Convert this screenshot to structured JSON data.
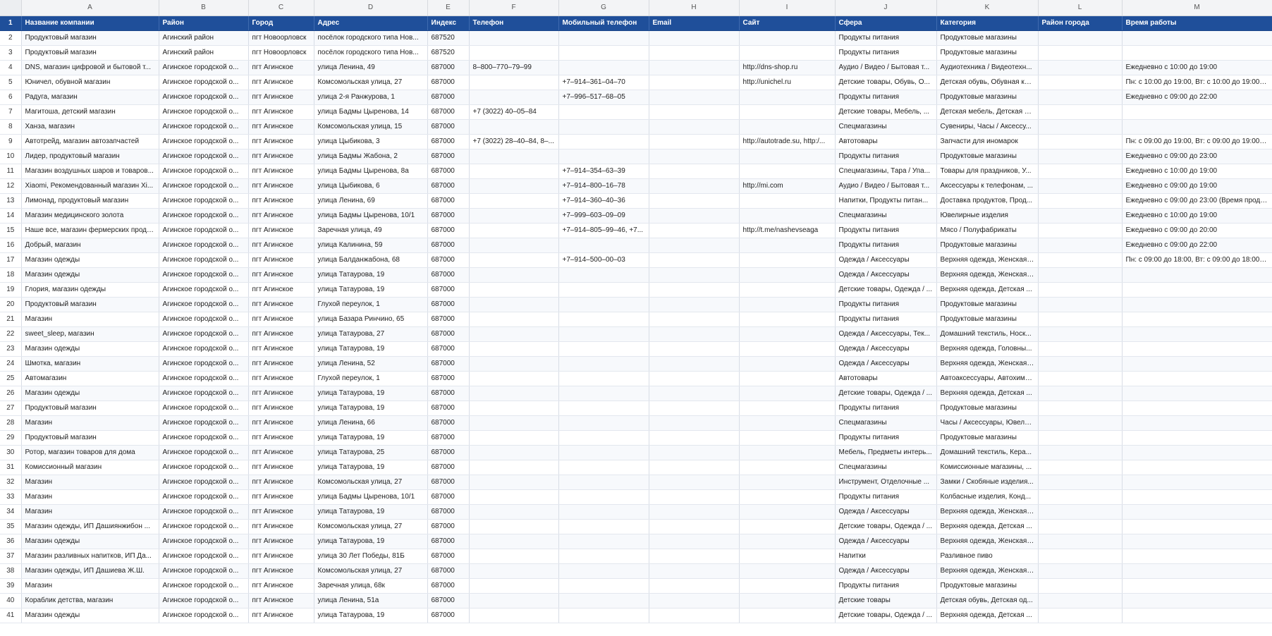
{
  "columns": [
    "",
    "A",
    "B",
    "C",
    "D",
    "E",
    "F",
    "G",
    "H",
    "I",
    "J",
    "K",
    "L",
    "M"
  ],
  "header": {
    "row_number": "1",
    "cells": [
      "Название компании",
      "Район",
      "Город",
      "Адрес",
      "Индекс",
      "Телефон",
      "Мобильный телефон",
      "Email",
      "Сайт",
      "Сфера",
      "Категория",
      "Район города",
      "Время работы"
    ]
  },
  "rows": [
    [
      "2",
      "Продуктовый магазин",
      "Агинский район",
      "пгт Новоорловск",
      "посёлок городского типа Нов...",
      "687520",
      "",
      "",
      "",
      "",
      "Продукты питания",
      "Продуктовые магазины",
      "",
      ""
    ],
    [
      "3",
      "Продуктовый магазин",
      "Агинский район",
      "пгт Новоорловск",
      "посёлок городского типа Нов...",
      "687520",
      "",
      "",
      "",
      "",
      "Продукты питания",
      "Продуктовые магазины",
      "",
      ""
    ],
    [
      "4",
      "DNS, магазин цифровой и бытовой т...",
      "Агинское городской о...",
      "пгт Агинское",
      "улица Ленина, 49",
      "687000",
      "8–800–770–79–99",
      "",
      "",
      "http://dns-shop.ru",
      "Аудио / Видео / Бытовая т...",
      "Аудиотехника / Видеотехн...",
      "",
      "Ежедневно с 10:00 до 19:00"
    ],
    [
      "5",
      "Юничел, обувной магазин",
      "Агинское городской о...",
      "пгт Агинское",
      "Комсомольская улица, 27",
      "687000",
      "",
      "+7–914–361–04–70",
      "",
      "http://unichel.ru",
      "Детские товары, Обувь, О...",
      "Детская обувь, Обувная ко...",
      "",
      "Пн: с 10:00 до 19:00, Вт: с 10:00 до 19:00, С..."
    ],
    [
      "6",
      "Радуга, магазин",
      "Агинское городской о...",
      "пгт Агинское",
      "улица 2-я Ранжурова, 1",
      "687000",
      "",
      "+7–996–517–68–05",
      "",
      "",
      "Продукты питания",
      "Продуктовые магазины",
      "",
      "Ежедневно с 09:00 до 22:00"
    ],
    [
      "7",
      "Магитоша, детский магазин",
      "Агинское городской о...",
      "пгт Агинское",
      "улица Бадмы Цыренова, 14",
      "687000",
      "+7 (3022) 40–05–84",
      "",
      "",
      "",
      "Детские товары, Мебель, ...",
      "Детская мебель, Детская о...",
      "",
      ""
    ],
    [
      "8",
      "Ханза, магазин",
      "Агинское городской о...",
      "пгт Агинское",
      "Комсомольская улица, 15",
      "687000",
      "",
      "",
      "",
      "",
      "Спецмагазины",
      "Сувениры, Часы / Аксессу...",
      "",
      ""
    ],
    [
      "9",
      "Автотрейд, магазин автозапчастей",
      "Агинское городской о...",
      "пгт Агинское",
      "улица Цыбикова, 3",
      "687000",
      "+7 (3022) 28–40–84, 8–...",
      "",
      "",
      "http://autotrade.su, http:/...",
      "Автотовары",
      "Запчасти для иномарок",
      "",
      "Пн: с 09:00 до 19:00, Вт: с 09:00 до 19:00, С..."
    ],
    [
      "10",
      "Лидер, продуктовый магазин",
      "Агинское городской о...",
      "пгт Агинское",
      "улица Бадмы Жабона, 2",
      "687000",
      "",
      "",
      "",
      "",
      "Продукты питания",
      "Продуктовые магазины",
      "",
      "Ежедневно с 09:00 до 23:00"
    ],
    [
      "11",
      "Магазин воздушных шаров и товаров...",
      "Агинское городской о...",
      "пгт Агинское",
      "улица Бадмы Цыренова, 8а",
      "687000",
      "",
      "+7–914–354–63–39",
      "",
      "",
      "Спецмагазины, Тара / Упа...",
      "Товары для праздников, У...",
      "",
      "Ежедневно с 10:00 до 19:00"
    ],
    [
      "12",
      "Xiaomi, Рекомендованный магазин Xi...",
      "Агинское городской о...",
      "пгт Агинское",
      "улица Цыбикова, 6",
      "687000",
      "",
      "+7–914–800–16–78",
      "",
      "http://mi.com",
      "Аудио / Видео / Бытовая т...",
      "Аксессуары к телефонам, ...",
      "",
      "Ежедневно с 09:00 до 19:00"
    ],
    [
      "13",
      "Лимонад, продуктовый магазин",
      "Агинское городской о...",
      "пгт Агинское",
      "улица Ленина, 69",
      "687000",
      "",
      "+7–914–360–40–36",
      "",
      "",
      "Напитки, Продукты питан...",
      "Доставка продуктов, Прод...",
      "",
      "Ежедневно с 09:00 до 23:00 (Время прода..."
    ],
    [
      "14",
      "Магазин медицинского золота",
      "Агинское городской о...",
      "пгт Агинское",
      "улица Бадмы Цыренова, 10/1",
      "687000",
      "",
      "+7–999–603–09–09",
      "",
      "",
      "Спецмагазины",
      "Ювелирные изделия",
      "",
      "Ежедневно с 10:00 до 19:00"
    ],
    [
      "15",
      "Наше все, магазин фермерских проду...",
      "Агинское городской о...",
      "пгт Агинское",
      "Заречная улица, 49",
      "687000",
      "",
      "+7–914–805–99–46, +7...",
      "",
      "http://t.me/nashevseaga",
      "Продукты питания",
      "Мясо / Полуфабрикаты",
      "",
      "Ежедневно с 09:00 до 20:00"
    ],
    [
      "16",
      "Добрый, магазин",
      "Агинское городской о...",
      "пгт Агинское",
      "улица Калинина, 59",
      "687000",
      "",
      "",
      "",
      "",
      "Продукты питания",
      "Продуктовые магазины",
      "",
      "Ежедневно с 09:00 до 22:00"
    ],
    [
      "17",
      "Магазин одежды",
      "Агинское городской о...",
      "пгт Агинское",
      "улица Балданжабона, 68",
      "687000",
      "",
      "+7–914–500–00–03",
      "",
      "",
      "Одежда / Аксессуары",
      "Верхняя одежда, Женская ...",
      "",
      "Пн: с 09:00 до 18:00, Вт: с 09:00 до 18:00, С..."
    ],
    [
      "18",
      "Магазин одежды",
      "Агинское городской о...",
      "пгт Агинское",
      "улица Татаурова, 19",
      "687000",
      "",
      "",
      "",
      "",
      "Одежда / Аксессуары",
      "Верхняя одежда, Женская ...",
      "",
      ""
    ],
    [
      "19",
      "Глория, магазин одежды",
      "Агинское городской о...",
      "пгт Агинское",
      "улица Татаурова, 19",
      "687000",
      "",
      "",
      "",
      "",
      "Детские товары, Одежда / ...",
      "Верхняя одежда, Детская ...",
      "",
      ""
    ],
    [
      "20",
      "Продуктовый магазин",
      "Агинское городской о...",
      "пгт Агинское",
      "Глухой переулок, 1",
      "687000",
      "",
      "",
      "",
      "",
      "Продукты питания",
      "Продуктовые магазины",
      "",
      ""
    ],
    [
      "21",
      "Магазин",
      "Агинское городской о...",
      "пгт Агинское",
      "улица Базара Ринчино, 65",
      "687000",
      "",
      "",
      "",
      "",
      "Продукты питания",
      "Продуктовые магазины",
      "",
      ""
    ],
    [
      "22",
      "sweet_sleep, магазин",
      "Агинское городской о...",
      "пгт Агинское",
      "улица Татаурова, 27",
      "687000",
      "",
      "",
      "",
      "",
      "Одежда / Аксессуары, Тек...",
      "Домашний текстиль, Носк...",
      "",
      ""
    ],
    [
      "23",
      "Магазин одежды",
      "Агинское городской о...",
      "пгт Агинское",
      "улица Татаурова, 19",
      "687000",
      "",
      "",
      "",
      "",
      "Одежда / Аксессуары",
      "Верхняя одежда, Головны...",
      "",
      ""
    ],
    [
      "24",
      "Шмотка, магазин",
      "Агинское городской о...",
      "пгт Агинское",
      "улица Ленина, 52",
      "687000",
      "",
      "",
      "",
      "",
      "Одежда / Аксессуары",
      "Верхняя одежда, Женская ...",
      "",
      ""
    ],
    [
      "25",
      "Автомагазин",
      "Агинское городской о...",
      "пгт Агинское",
      "Глухой переулок, 1",
      "687000",
      "",
      "",
      "",
      "",
      "Автотовары",
      "Автоаксессуары, Автохими...",
      "",
      ""
    ],
    [
      "26",
      "Магазин одежды",
      "Агинское городской о...",
      "пгт Агинское",
      "улица Татаурова, 19",
      "687000",
      "",
      "",
      "",
      "",
      "Детские товары, Одежда / ...",
      "Верхняя одежда, Детская ...",
      "",
      ""
    ],
    [
      "27",
      "Продуктовый магазин",
      "Агинское городской о...",
      "пгт Агинское",
      "улица Татаурова, 19",
      "687000",
      "",
      "",
      "",
      "",
      "Продукты питания",
      "Продуктовые магазины",
      "",
      ""
    ],
    [
      "28",
      "Магазин",
      "Агинское городской о...",
      "пгт Агинское",
      "улица Ленина, 66",
      "687000",
      "",
      "",
      "",
      "",
      "Спецмагазины",
      "Часы / Аксессуары, Ювели...",
      "",
      ""
    ],
    [
      "29",
      "Продуктовый магазин",
      "Агинское городской о...",
      "пгт Агинское",
      "улица Татаурова, 19",
      "687000",
      "",
      "",
      "",
      "",
      "Продукты питания",
      "Продуктовые магазины",
      "",
      ""
    ],
    [
      "30",
      "Ротор, магазин товаров для дома",
      "Агинское городской о...",
      "пгт Агинское",
      "улица Татаурова, 25",
      "687000",
      "",
      "",
      "",
      "",
      "Мебель, Предметы интерь...",
      "Домашний текстиль, Кера...",
      "",
      ""
    ],
    [
      "31",
      "Комиссионный магазин",
      "Агинское городской о...",
      "пгт Агинское",
      "улица Татаурова, 19",
      "687000",
      "",
      "",
      "",
      "",
      "Спецмагазины",
      "Комиссионные магазины, ...",
      "",
      ""
    ],
    [
      "32",
      "Магазин",
      "Агинское городской о...",
      "пгт Агинское",
      "Комсомольская улица, 27",
      "687000",
      "",
      "",
      "",
      "",
      "Инструмент, Отделочные ...",
      "Замки / Скобяные изделия...",
      "",
      ""
    ],
    [
      "33",
      "Магазин",
      "Агинское городской о...",
      "пгт Агинское",
      "улица Бадмы Цыренова, 10/1",
      "687000",
      "",
      "",
      "",
      "",
      "Продукты питания",
      "Колбасные изделия, Конд...",
      "",
      ""
    ],
    [
      "34",
      "Магазин",
      "Агинское городской о...",
      "пгт Агинское",
      "улица Татаурова, 19",
      "687000",
      "",
      "",
      "",
      "",
      "Одежда / Аксессуары",
      "Верхняя одежда, Женская ...",
      "",
      ""
    ],
    [
      "35",
      "Магазин одежды, ИП Дашиянжибон ...",
      "Агинское городской о...",
      "пгт Агинское",
      "Комсомольская улица, 27",
      "687000",
      "",
      "",
      "",
      "",
      "Детские товары, Одежда / ...",
      "Верхняя одежда, Детская ...",
      "",
      ""
    ],
    [
      "36",
      "Магазин одежды",
      "Агинское городской о...",
      "пгт Агинское",
      "улица Татаурова, 19",
      "687000",
      "",
      "",
      "",
      "",
      "Одежда / Аксессуары",
      "Верхняя одежда, Женская ...",
      "",
      ""
    ],
    [
      "37",
      "Магазин разливных напитков, ИП Да...",
      "Агинское городской о...",
      "пгт Агинское",
      "улица 30 Лет Победы, 81Б",
      "687000",
      "",
      "",
      "",
      "",
      "Напитки",
      "Разливное пиво",
      "",
      ""
    ],
    [
      "38",
      "Магазин одежды, ИП Дашиева Ж.Ш.",
      "Агинское городской о...",
      "пгт Агинское",
      "Комсомольская улица, 27",
      "687000",
      "",
      "",
      "",
      "",
      "Одежда / Аксессуары",
      "Верхняя одежда, Женская ...",
      "",
      ""
    ],
    [
      "39",
      "Магазин",
      "Агинское городской о...",
      "пгт Агинское",
      "Заречная улица, 68к",
      "687000",
      "",
      "",
      "",
      "",
      "Продукты питания",
      "Продуктовые магазины",
      "",
      ""
    ],
    [
      "40",
      "Кораблик детства, магазин",
      "Агинское городской о...",
      "пгт Агинское",
      "улица Ленина, 51а",
      "687000",
      "",
      "",
      "",
      "",
      "Детские товары",
      "Детская обувь, Детская од...",
      "",
      ""
    ],
    [
      "41",
      "Магазин одежды",
      "Агинское городской о...",
      "пгт Агинское",
      "улица Татаурова, 19",
      "687000",
      "",
      "",
      "",
      "",
      "Детские товары, Одежда / ...",
      "Верхняя одежда, Детская ...",
      "",
      ""
    ]
  ]
}
